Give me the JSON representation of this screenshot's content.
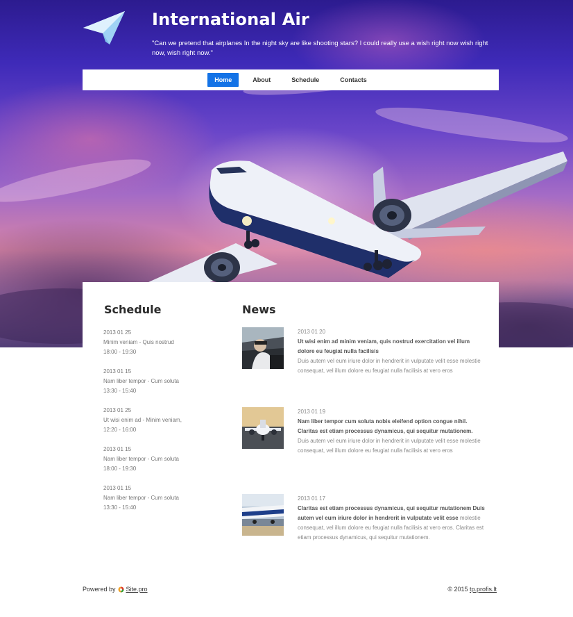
{
  "header": {
    "title": "International Air",
    "tagline": "\"Can we pretend that airplanes In the night sky are like shooting stars? I could really use a wish right now wish right now, wish right now.\""
  },
  "nav": {
    "items": [
      {
        "label": "Home",
        "active": true
      },
      {
        "label": "About",
        "active": false
      },
      {
        "label": "Schedule",
        "active": false
      },
      {
        "label": "Contacts",
        "active": false
      }
    ]
  },
  "schedule": {
    "title": "Schedule",
    "entries": [
      {
        "date": "2013 01 25",
        "route": "Minim veniam - Quis nostrud",
        "time": "18:00 - 19:30"
      },
      {
        "date": "2013 01 15",
        "route": "Nam liber tempor - Cum soluta",
        "time": "13:30 - 15:40"
      },
      {
        "date": "2013 01 25",
        "route": "Ut wisi enim ad - Minim veniam,",
        "time": "12:20 - 16:00"
      },
      {
        "date": "2013 01 15",
        "route": "Nam liber tempor - Cum soluta",
        "time": "18:00 - 19:30"
      },
      {
        "date": "2013 01 15",
        "route": "Nam liber tempor - Cum soluta",
        "time": "13:30 - 15:40"
      }
    ]
  },
  "news": {
    "title": "News",
    "items": [
      {
        "date": "2013 01 20",
        "headline": "Ut wisi enim ad minim veniam, quis nostrud exercitation vel illum dolore eu feugiat nulla facilisis",
        "body": "Duis autem vel eum iriure dolor in hendrerit in vulputate velit esse molestie consequat, vel illum dolore eu feugiat nulla facilisis at vero eros"
      },
      {
        "date": "2013 01 19",
        "headline": "Nam liber tempor cum soluta nobis eleifend option congue nihil. Claritas est etiam processus dynamicus, qui sequitur mutationem.",
        "body": "Duis autem vel eum iriure dolor in hendrerit in vulputate velit esse molestie consequat, vel illum dolore eu feugiat nulla facilisis at vero eros"
      },
      {
        "date": "2013 01 17",
        "headline": "Claritas est etiam processus dynamicus, qui sequitur mutationem Duis autem vel eum iriure dolor in hendrerit in vulputate velit esse",
        "body": "molestie consequat, vel illum dolore eu feugiat nulla facilisis at vero eros. Claritas est etiam processus dynamicus, qui sequitur mutationem."
      }
    ]
  },
  "footer": {
    "powered_by": "Powered by",
    "powered_link": "Site.pro",
    "copyright": "© 2015",
    "copyright_link": "tp.profis.lt"
  },
  "colors": {
    "nav_active": "#1473e6",
    "title_text": "#ffffff"
  },
  "icons": {
    "logo": "paper-plane-icon",
    "sitepro": "sitepro-logo-icon"
  }
}
